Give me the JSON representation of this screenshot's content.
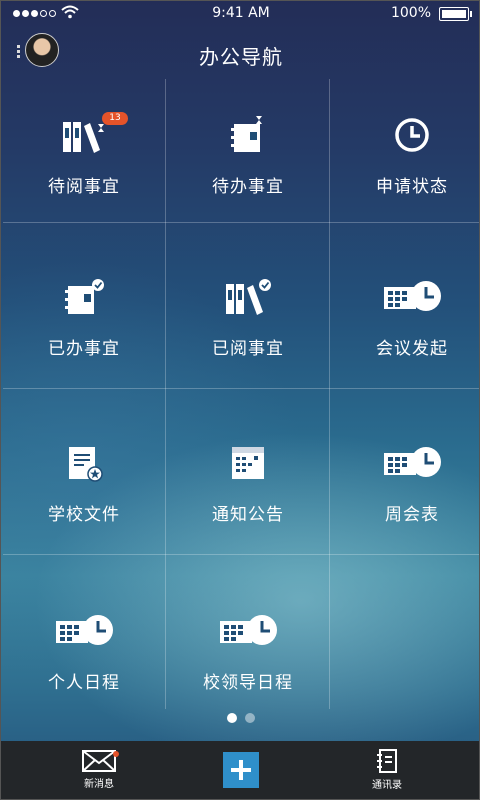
{
  "status_bar": {
    "time": "9:41 AM",
    "battery": "100%"
  },
  "header": {
    "title": "办公导航"
  },
  "grid": {
    "pending_review": {
      "label": "待阅事宜",
      "badge": "13"
    },
    "todo": {
      "label": "待办事宜"
    },
    "application_status": {
      "label": "申请状态"
    },
    "done": {
      "label": "已办事宜"
    },
    "reviewed": {
      "label": "已阅事宜"
    },
    "meeting_request": {
      "label": "会议发起"
    },
    "school_documents": {
      "label": "学校文件"
    },
    "notices": {
      "label": "通知公告"
    },
    "weekly_meetings": {
      "label": "周会表"
    },
    "personal_schedule": {
      "label": "个人日程"
    },
    "leader_schedule": {
      "label": "校领导日程"
    }
  },
  "pager": {
    "pages": 2,
    "active": 1
  },
  "tabbar": {
    "messages": "新消息",
    "contacts": "通讯录"
  },
  "colors": {
    "accent": "#2f8fca",
    "badge": "#e5532a",
    "tabbar": "#232629"
  }
}
